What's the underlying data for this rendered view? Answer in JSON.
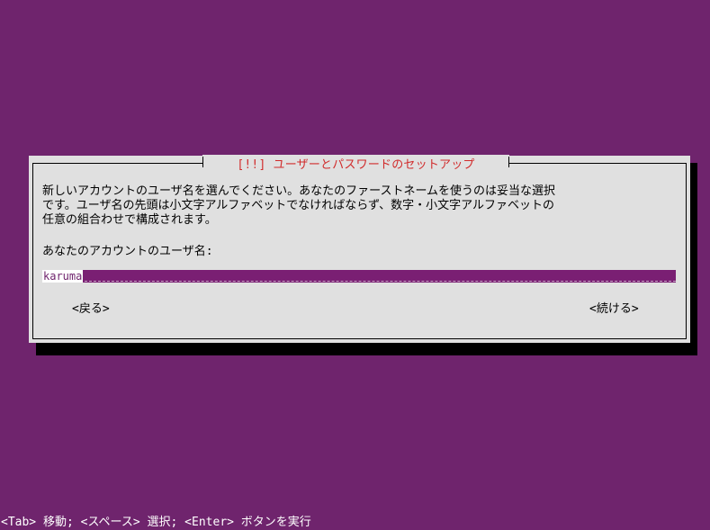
{
  "dialog": {
    "title": "[!!] ユーザーとパスワードのセットアップ",
    "description_lines": [
      "新しいアカウントのユーザ名を選んでください。あなたのファーストネームを使うのは妥当な選択",
      "です。ユーザ名の先頭は小文字アルファベットでなければならず、数字・小文字アルファベットの",
      "任意の組合わせで構成されます。"
    ],
    "prompt": "あなたのアカウントのユーザ名:",
    "input_value": "karuma",
    "back_button": "<戻る>",
    "continue_button": "<続ける>"
  },
  "status_bar": {
    "text": "<Tab> 移動; <スペース> 選択; <Enter> ボタンを実行"
  },
  "colors": {
    "background": "#6f246d",
    "dialog": "#e0e0e0",
    "title": "#d12b2b",
    "input_bar": "#7a1f73",
    "shadow": "#000000"
  }
}
